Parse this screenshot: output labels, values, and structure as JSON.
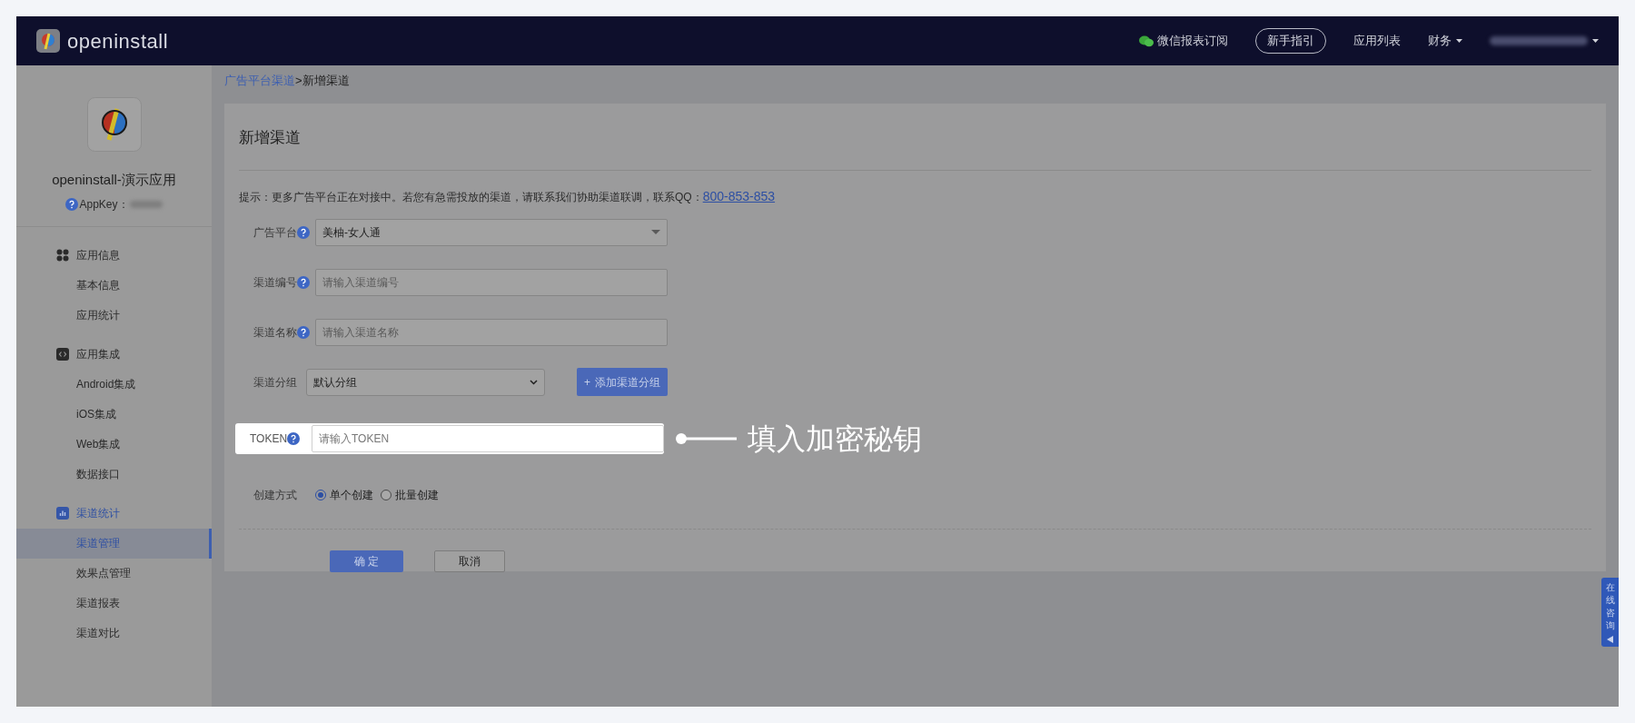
{
  "header": {
    "logo_text": "openinstall",
    "nav": [
      {
        "kind": "wechat",
        "label": "微信报表订阅"
      },
      {
        "kind": "outlined",
        "label": "新手指引"
      },
      {
        "kind": "link",
        "label": "应用列表"
      },
      {
        "kind": "dropdown",
        "label": "财务"
      }
    ]
  },
  "sidebar": {
    "app_name": "openinstall-演示应用",
    "appkey_label": "AppKey：",
    "groups": [
      {
        "label": "应用信息",
        "selected": false,
        "children": [
          {
            "label": "基本信息",
            "selected": false
          },
          {
            "label": "应用统计",
            "selected": false
          }
        ]
      },
      {
        "label": "应用集成",
        "selected": false,
        "children": [
          {
            "label": "Android集成",
            "selected": false
          },
          {
            "label": "iOS集成",
            "selected": false
          },
          {
            "label": "Web集成",
            "selected": false
          },
          {
            "label": "数据接口",
            "selected": false
          }
        ]
      },
      {
        "label": "渠道统计",
        "selected": true,
        "children": [
          {
            "label": "渠道管理",
            "selected": true
          },
          {
            "label": "效果点管理",
            "selected": false
          },
          {
            "label": "渠道报表",
            "selected": false
          },
          {
            "label": "渠道对比",
            "selected": false
          }
        ]
      }
    ]
  },
  "breadcrumb": [
    {
      "label": "广告平台渠道",
      "kind": "link"
    },
    {
      "label": ">",
      "kind": "separator"
    },
    {
      "label": "新增渠道",
      "kind": "current"
    }
  ],
  "form": {
    "title": "新增渠道",
    "hint": {
      "text": "提示：更多广告平台正在对接中。若您有急需投放的渠道，请联系我们协助渠道联调，联系QQ：",
      "link": "800-853-853"
    },
    "fields": [
      {
        "kind": "select",
        "label": "广告平台",
        "help": true,
        "highlighted": false,
        "value": "美柚-女人通"
      },
      {
        "kind": "input",
        "label": "渠道编号",
        "help": true,
        "highlighted": false,
        "placeholder": "请输入渠道编号"
      },
      {
        "kind": "input",
        "label": "渠道名称",
        "help": true,
        "highlighted": false,
        "placeholder": "请输入渠道名称"
      },
      {
        "kind": "group",
        "label": "渠道分组",
        "help": false,
        "highlighted": false,
        "value": "默认分组",
        "button": "添加渠道分组",
        "button_icon": "+"
      },
      {
        "kind": "input",
        "label": "TOKEN",
        "help": true,
        "highlighted": true,
        "placeholder": "请输入TOKEN"
      },
      {
        "kind": "radio",
        "label": "创建方式",
        "help": false,
        "highlighted": false,
        "options": [
          {
            "label": "单个创建",
            "selected": true
          },
          {
            "label": "批量创建",
            "selected": false
          }
        ]
      }
    ],
    "confirm": "确 定",
    "cancel": "取消"
  },
  "annotation": "填入加密秘钥",
  "float_tab": "在线咨询"
}
